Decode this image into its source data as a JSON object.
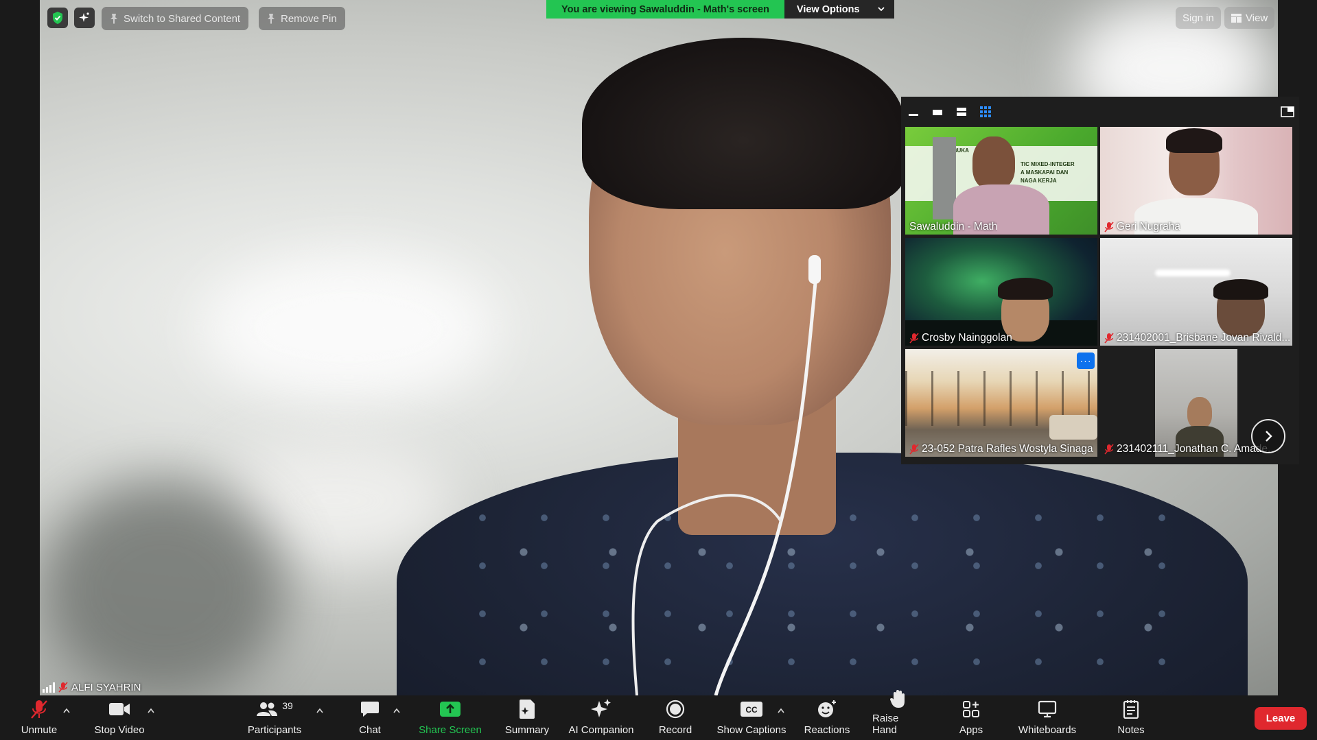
{
  "top_left": {
    "switch_shared_label": "Switch to Shared Content",
    "remove_pin_label": "Remove Pin"
  },
  "banner": {
    "viewing_text": "You are viewing Sawaluddin - Math's screen",
    "view_options_label": "View Options"
  },
  "top_right": {
    "sign_in_label": "Sign in",
    "view_label": "View"
  },
  "main_video": {
    "participant_name": "ALFI SYAHRIN"
  },
  "gallery": {
    "tiles": [
      {
        "name": "Sawaluddin - Math",
        "muted": false,
        "slide_lines": [
          "AN TERBUKA",
          "TIC  MIXED-INTEGER",
          "A  MASKAPAI  DAN",
          "NAGA KERJA"
        ]
      },
      {
        "name": "Geri Nugraha",
        "muted": true
      },
      {
        "name": "Crosby Nainggolan",
        "muted": true
      },
      {
        "name": "231402001_Brisbane Jovan Rivald...",
        "muted": true
      },
      {
        "name": "23-052 Patra Rafles Wostyla Sinaga",
        "muted": true
      },
      {
        "name": "231402111_Jonathan C. Amade...",
        "muted": true
      }
    ]
  },
  "toolbar": {
    "unmute": "Unmute",
    "stop_video": "Stop Video",
    "participants": "Participants",
    "participants_count": "39",
    "chat": "Chat",
    "share_screen": "Share Screen",
    "summary": "Summary",
    "ai_companion": "AI Companion",
    "record": "Record",
    "show_captions": "Show Captions",
    "reactions": "Reactions",
    "raise_hand": "Raise Hand",
    "apps": "Apps",
    "whiteboards": "Whiteboards",
    "notes": "Notes",
    "leave": "Leave"
  },
  "colors": {
    "banner_green": "#23c552",
    "share_green": "#23c552",
    "leave_red": "#e0282e",
    "mute_red": "#e0282e",
    "gallery_active_blue": "#0e72ed"
  },
  "icons": [
    "shield-icon",
    "sparkle-icon",
    "pin-icon",
    "chevron-down-icon",
    "grid-view-icon",
    "mic-muted-icon",
    "camera-icon",
    "people-icon",
    "chat-icon",
    "share-arrow-icon",
    "summary-icon",
    "ai-sparkle-icon",
    "record-icon",
    "cc-icon",
    "emoji-icon",
    "hand-icon",
    "apps-icon",
    "whiteboard-icon",
    "notes-icon",
    "signal-icon",
    "next-arrow-icon",
    "more-icon"
  ]
}
